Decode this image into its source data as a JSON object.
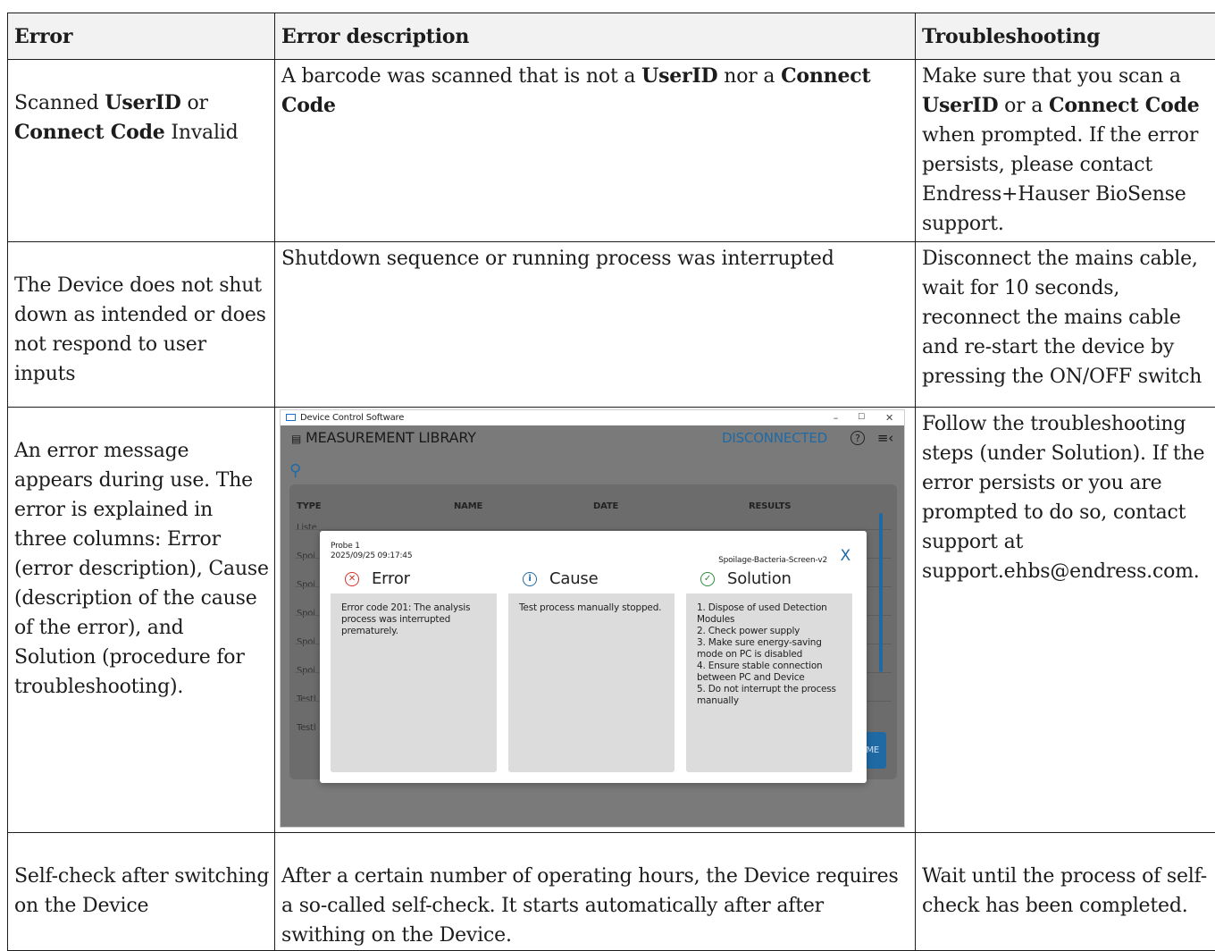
{
  "table": {
    "headers": [
      "Error",
      "Error description",
      "Troubleshooting"
    ],
    "rows": [
      {
        "error_parts": [
          "Scanned ",
          "UserID",
          " or ",
          "Connect Code",
          " Invalid"
        ],
        "description_parts": [
          "A barcode was scanned that is not a ",
          "UserID",
          " nor a ",
          "Connect Code"
        ],
        "troubleshooting_parts": [
          "Make sure that you scan a ",
          "UserID",
          " or a ",
          "Connect Code",
          " when prompted. If the error persists, please contact Endress+Hauser BioSense support."
        ]
      },
      {
        "error": "The Device does not shut down as intended or does not respond to user inputs",
        "description": "Shutdown sequence or running process was interrupted",
        "troubleshooting": "Disconnect the mains cable, wait for 10 seconds, reconnect the mains cable and re-start the device by pressing the ON/OFF switch"
      },
      {
        "error": "An error message appears during use. The error is explained in three columns: Error (error description), Cause (description of the cause of the error), and Solution (procedure for troubleshooting).",
        "troubleshooting": "Follow the troubleshooting steps (under Solution). If the error persists or you are prompted to do so, contact support at support.ehbs@endress.com."
      },
      {
        "error": "Self-check after switching on the Device",
        "description": "After a certain number of operating hours, the Device requires a so-called self-check. It starts automatically after after swithing on the Device.",
        "troubleshooting": "Wait until the process of self-check has been completed."
      }
    ]
  },
  "screenshot": {
    "window_title": "Device Control Software",
    "window_controls": {
      "minimize": "–",
      "maximize": "☐",
      "close": "✕"
    },
    "app_title": "MEASUREMENT LIBRARY",
    "connection_status": "DISCONNECTED",
    "help_glyph": "?",
    "menu_glyph": "≡‹",
    "search_glyph": "⚲",
    "list_headers": {
      "type": "TYPE",
      "name": "NAME",
      "date": "DATE",
      "results": "RESULTS"
    },
    "list_rows": [
      "Liste",
      "Spoi",
      "Spoi",
      "Spoi",
      "Spoi",
      "Spoi",
      "Testl",
      "Testl"
    ],
    "back_button": "BACK TO HOME",
    "dialog": {
      "probe": "Probe 1",
      "datetime": "2025/09/25 09:17:45",
      "test_name": "Spoilage-Bacteria-Screen-v2",
      "close": "X",
      "error_title": "Error",
      "error_text": "Error code 201: The analysis process was interrupted prematurely.",
      "cause_title": "Cause",
      "cause_text": "Test process manually stopped.",
      "solution_title": "Solution",
      "solution_steps": [
        "1. Dispose of used Detection Modules",
        "2. Check power supply",
        "3. Make sure energy-saving mode on PC is disabled",
        "4. Ensure stable connection between PC and Device",
        "5. Do not interrupt the process manually"
      ],
      "icons": {
        "error": "error-circle-icon",
        "cause": "info-circle-icon",
        "solution": "check-circle-icon"
      },
      "colors": {
        "error": "#d0332b",
        "cause": "#1f6aa5",
        "solution": "#2e8b3d"
      }
    }
  }
}
